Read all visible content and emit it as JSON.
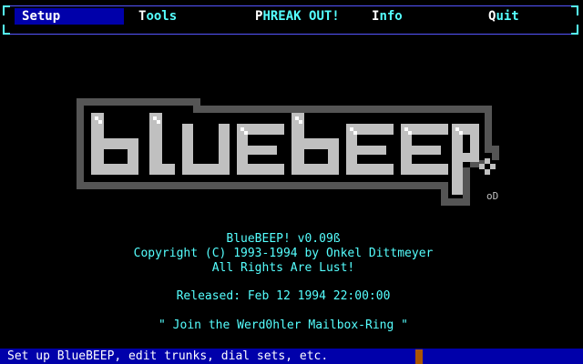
{
  "menu": {
    "items": [
      {
        "hotkey": "S",
        "rest": "etup"
      },
      {
        "hotkey": "T",
        "rest": "ools"
      },
      {
        "hotkey": "P",
        "rest": "HREAK OUT!"
      },
      {
        "hotkey": "I",
        "rest": "nfo"
      },
      {
        "hotkey": "Q",
        "rest": "uit"
      }
    ],
    "selected": "Setup"
  },
  "logo": {
    "text": "bluebeep",
    "signature": "oD"
  },
  "info": {
    "version": "BlueBEEP! v0.09ß",
    "copyright": "Copyright (C) 1993-1994 by Onkel Dittmeyer",
    "rights": "All Rights Are Lust!",
    "released": "Released: Feb 12 1994 22:00:00",
    "slogan": "\" Join the Werd0hler Mailbox-Ring \""
  },
  "status": {
    "text": "Set up BlueBEEP, edit trunks, dial sets, etc."
  },
  "colors": {
    "background": "#000000",
    "text_cyan": "#55ffff",
    "menu_highlight": "#0000aa",
    "frame_blue": "#5555ff",
    "logo_light": "#c0c0c0",
    "logo_dark": "#555555",
    "cursor": "#aa5500"
  }
}
